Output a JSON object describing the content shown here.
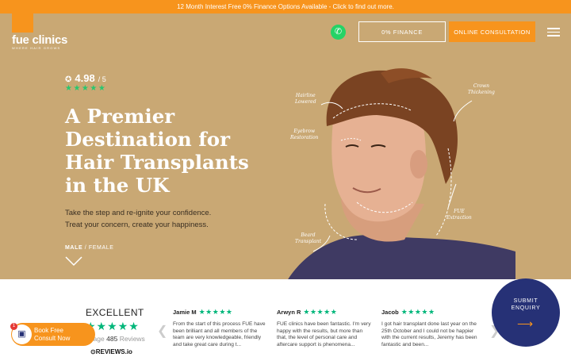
{
  "topbar": {
    "text": "12 Month Interest Free 0% Finance Options Available - Click to find out more."
  },
  "header": {
    "logo": "fue clinics",
    "tagline": "WHERE HAIR GROWS",
    "finance_label": "0% FINANCE",
    "consult_label": "ONLINE CONSULTATION"
  },
  "hero": {
    "rating_value": "4.98",
    "rating_max": "/ 5",
    "stars": "★★★★★",
    "headline": "A Premier Destination for Hair Transplants in the UK",
    "sub_line1": "Take the step and re-ignite your confidence.",
    "sub_line2": "Treat your concern, create your happiness.",
    "gender_male": "MALE",
    "gender_female": "/ FEMALE"
  },
  "annotations": {
    "hairline": "Hairline\nLowered",
    "crown": "Crown\nThickening",
    "eyebrow": "Eyebrow\nRestoration",
    "fue": "FUE\nExtraction",
    "beard": "Beard\nTransplant"
  },
  "reviews": {
    "summary_label": "EXCELLENT",
    "summary_stars": "★★★★★",
    "avg_prefix": "erage",
    "avg_count": "485",
    "avg_suffix": "Reviews",
    "brand": "REVIEWS.io",
    "items": [
      {
        "name": "Jamie M",
        "stars": "★★★★★",
        "text": "From the start of this process FUE have been brilliant and all members of the team are very knowledgeable, friendly and take great care during t..."
      },
      {
        "name": "Arwyn R",
        "stars": "★★★★★",
        "text": "FUE clinics have been fantastic. I'm very happy with the results, but more than that, the level of personal care and aftercare support is phenomena..."
      },
      {
        "name": "Jacob",
        "stars": "★★★★★",
        "text": "I got hair transplant done last year on the 25th October and I could not be happier with the current results, Jeremy has been fantastic and been..."
      }
    ]
  },
  "submit": {
    "line1": "SUBMIT",
    "line2": "ENQUIRY"
  },
  "book": {
    "line1": "Book Free",
    "line2": "Consult Now",
    "badge": "1"
  },
  "colors": {
    "brand_orange": "#f7941d",
    "hero_tan": "#c9a874",
    "navy": "#263176",
    "star_green": "#00b67a"
  }
}
